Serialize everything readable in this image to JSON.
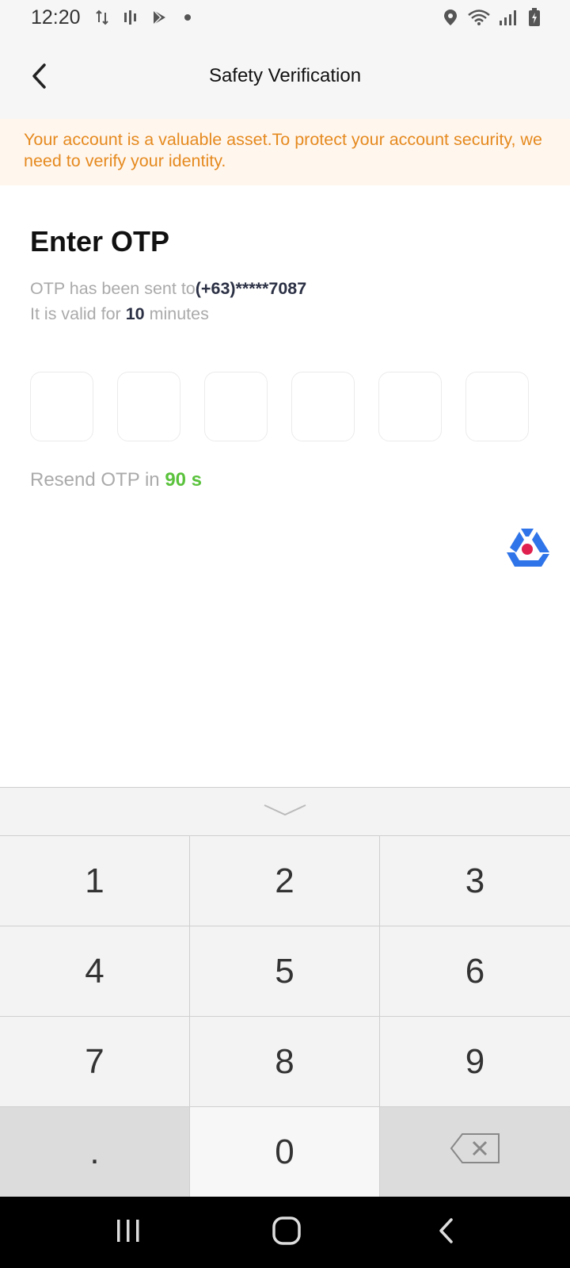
{
  "status_bar": {
    "time": "12:20",
    "left_icons": [
      "data-transfer-icon",
      "sim-toolkit-icon",
      "play-store-icon",
      "dot-icon"
    ],
    "right_icons": [
      "location-icon",
      "wifi-icon",
      "signal-icon",
      "battery-charging-icon"
    ]
  },
  "header": {
    "title": "Safety Verification",
    "back_icon": "chevron-left-icon"
  },
  "notice": {
    "text": "Your account is a valuable asset.To protect your account security, we need to verify your identity.",
    "color": "#e58a1f",
    "background": "#fff6ee"
  },
  "otp": {
    "heading": "Enter OTP",
    "sent_prefix": "OTP has been sent to",
    "phone": "(+63)*****7087",
    "valid_prefix": "It is valid for ",
    "valid_minutes": "10",
    "valid_suffix": " minutes",
    "box_count": 6,
    "resend_prefix": "Resend OTP in ",
    "resend_countdown": "90 s",
    "countdown_color": "#5ac23c"
  },
  "floating_logo": {
    "icon": "app-logo-icon",
    "colors": [
      "#2f74e8",
      "#e0204f"
    ]
  },
  "keyboard": {
    "collapse_icon": "chevron-down-icon",
    "keys": [
      "1",
      "2",
      "3",
      "4",
      "5",
      "6",
      "7",
      "8",
      "9",
      ".",
      "0",
      "⌫"
    ],
    "backspace_icon": "backspace-icon"
  },
  "nav_bar": {
    "icons": [
      "recent-apps-icon",
      "home-icon",
      "back-icon"
    ]
  }
}
